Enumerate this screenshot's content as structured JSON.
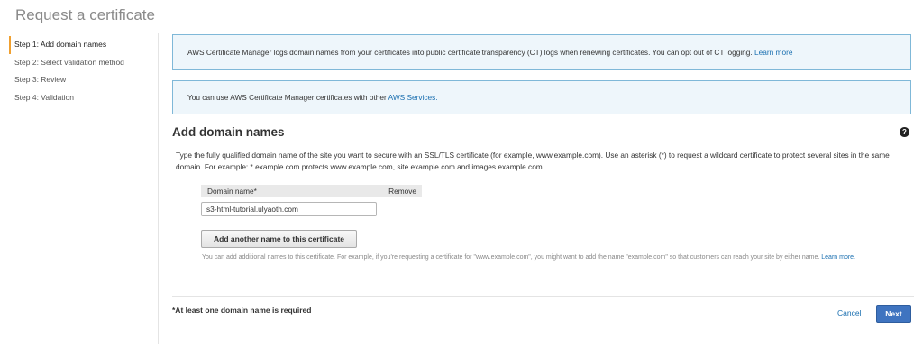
{
  "page": {
    "title": "Request a certificate"
  },
  "steps": [
    {
      "label": "Step 1: Add domain names",
      "active": true
    },
    {
      "label": "Step 2: Select validation method",
      "active": false
    },
    {
      "label": "Step 3: Review",
      "active": false
    },
    {
      "label": "Step 4: Validation",
      "active": false
    }
  ],
  "info_ct": {
    "text": "AWS Certificate Manager logs domain names from your certificates into public certificate transparency (CT) logs when renewing certificates. You can opt out of CT logging.",
    "link": "Learn more"
  },
  "info_services": {
    "text": "You can use AWS Certificate Manager certificates with other",
    "link": "AWS Services."
  },
  "section": {
    "title": "Add domain names",
    "help_icon": "help-icon",
    "description": "Type the fully qualified domain name of the site you want to secure with an SSL/TLS certificate (for example, www.example.com). Use an asterisk (*) to request a wildcard certificate to protect several sites in the same domain. For example: *.example.com protects www.example.com, site.example.com and images.example.com."
  },
  "domain_table": {
    "col_domain": "Domain name*",
    "col_remove": "Remove",
    "value": "s3-html-tutorial.ulyaoth.com"
  },
  "add_button": "Add another name to this certificate",
  "hint": {
    "text": "You can add additional names to this certificate. For example, if you're requesting a certificate for \"www.example.com\", you might want to add the name \"example.com\" so that customers can reach your site by either name.",
    "link": "Learn more."
  },
  "footer": {
    "required": "*At least one domain name is required",
    "cancel": "Cancel",
    "next": "Next"
  }
}
